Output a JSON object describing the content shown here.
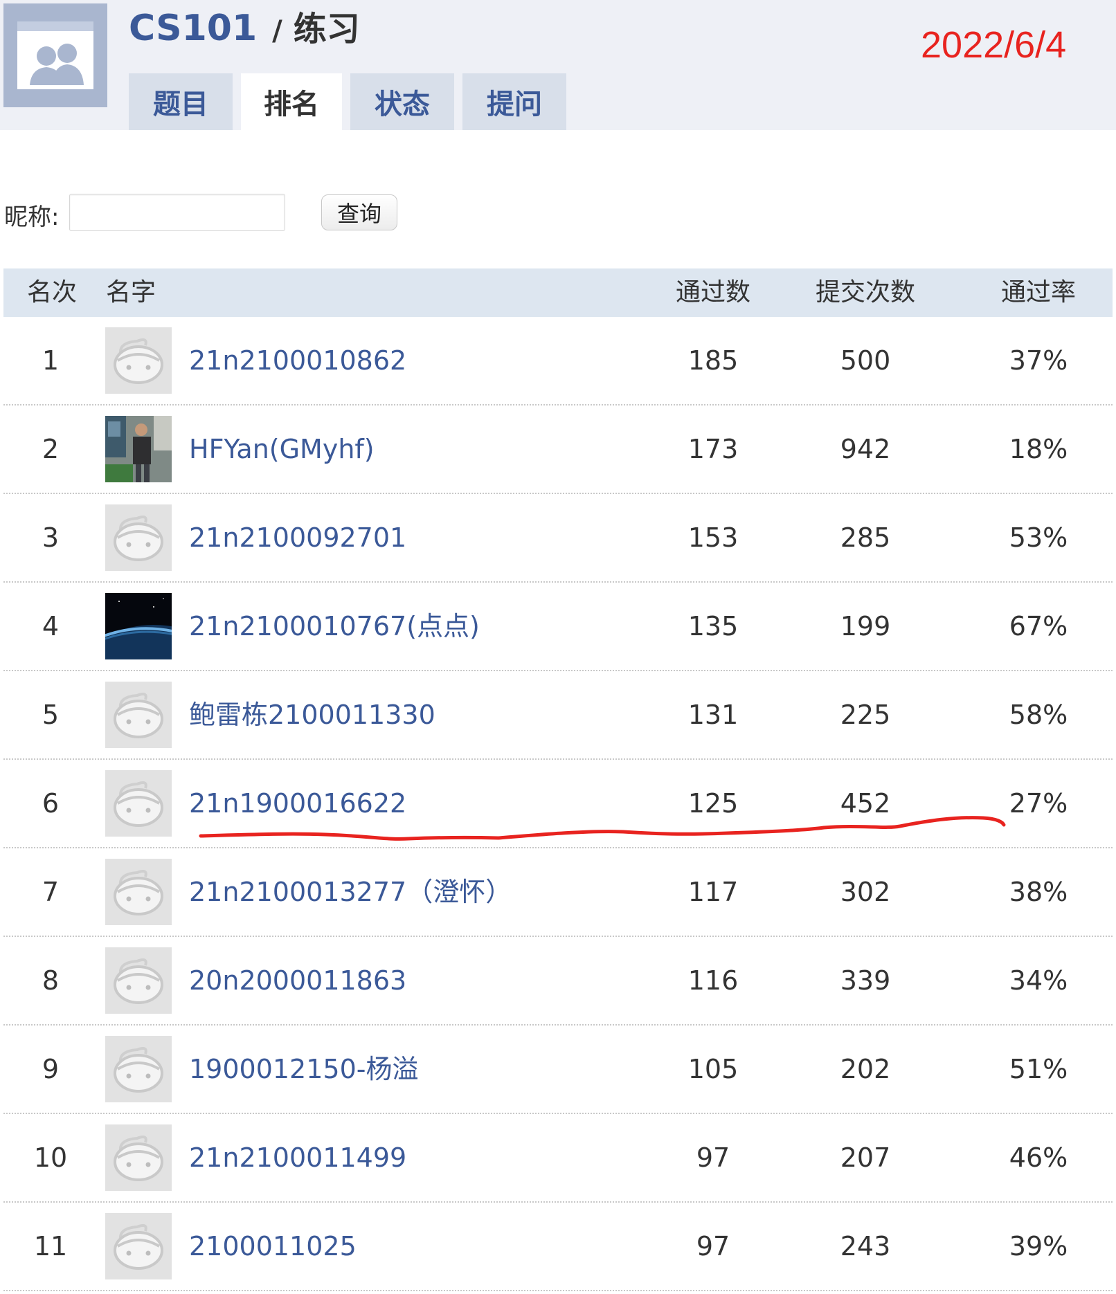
{
  "header": {
    "course": "CS101",
    "separator": "/",
    "section": "练习",
    "date_annotation": "2022/6/4",
    "date_annotation_color": "#e8231f",
    "group_avatar_icon": "group-silhouette-icon"
  },
  "tabs": [
    {
      "label": "题目",
      "active": false
    },
    {
      "label": "排名",
      "active": true
    },
    {
      "label": "状态",
      "active": false
    },
    {
      "label": "提问",
      "active": false
    }
  ],
  "search": {
    "label": "昵称:",
    "value": "",
    "placeholder": "",
    "button_label": "查询"
  },
  "table": {
    "headers": {
      "rank": "名次",
      "name": "名字",
      "passed": "通过数",
      "submits": "提交次数",
      "rate": "通过率"
    },
    "rows": [
      {
        "rank": "1",
        "name": "21n2100010862",
        "passed": "185",
        "submits": "500",
        "rate": "37%",
        "avatar": "default-avatar-icon"
      },
      {
        "rank": "2",
        "name": "HFYan(GMyhf)",
        "passed": "173",
        "submits": "942",
        "rate": "18%",
        "avatar": "person-photo"
      },
      {
        "rank": "3",
        "name": "21n2100092701",
        "passed": "153",
        "submits": "285",
        "rate": "53%",
        "avatar": "default-avatar-icon"
      },
      {
        "rank": "4",
        "name": "21n2100010767(点点)",
        "passed": "135",
        "submits": "199",
        "rate": "67%",
        "avatar": "planet-photo"
      },
      {
        "rank": "5",
        "name": "鲍雷栋2100011330",
        "passed": "131",
        "submits": "225",
        "rate": "58%",
        "avatar": "default-avatar-icon"
      },
      {
        "rank": "6",
        "name": "21n1900016622",
        "passed": "125",
        "submits": "452",
        "rate": "27%",
        "avatar": "default-avatar-icon"
      },
      {
        "rank": "7",
        "name": "21n2100013277（澄怀）",
        "passed": "117",
        "submits": "302",
        "rate": "38%",
        "avatar": "default-avatar-icon"
      },
      {
        "rank": "8",
        "name": "20n2000011863",
        "passed": "116",
        "submits": "339",
        "rate": "34%",
        "avatar": "default-avatar-icon"
      },
      {
        "rank": "9",
        "name": "1900012150-杨溢",
        "passed": "105",
        "submits": "202",
        "rate": "51%",
        "avatar": "default-avatar-icon"
      },
      {
        "rank": "10",
        "name": "21n2100011499",
        "passed": "97",
        "submits": "207",
        "rate": "46%",
        "avatar": "default-avatar-icon"
      },
      {
        "rank": "11",
        "name": "2100011025",
        "passed": "97",
        "submits": "243",
        "rate": "39%",
        "avatar": "default-avatar-icon"
      }
    ]
  },
  "annotation": {
    "type": "hand-drawn-underline",
    "color": "#e8231f",
    "row_rank": "6"
  }
}
